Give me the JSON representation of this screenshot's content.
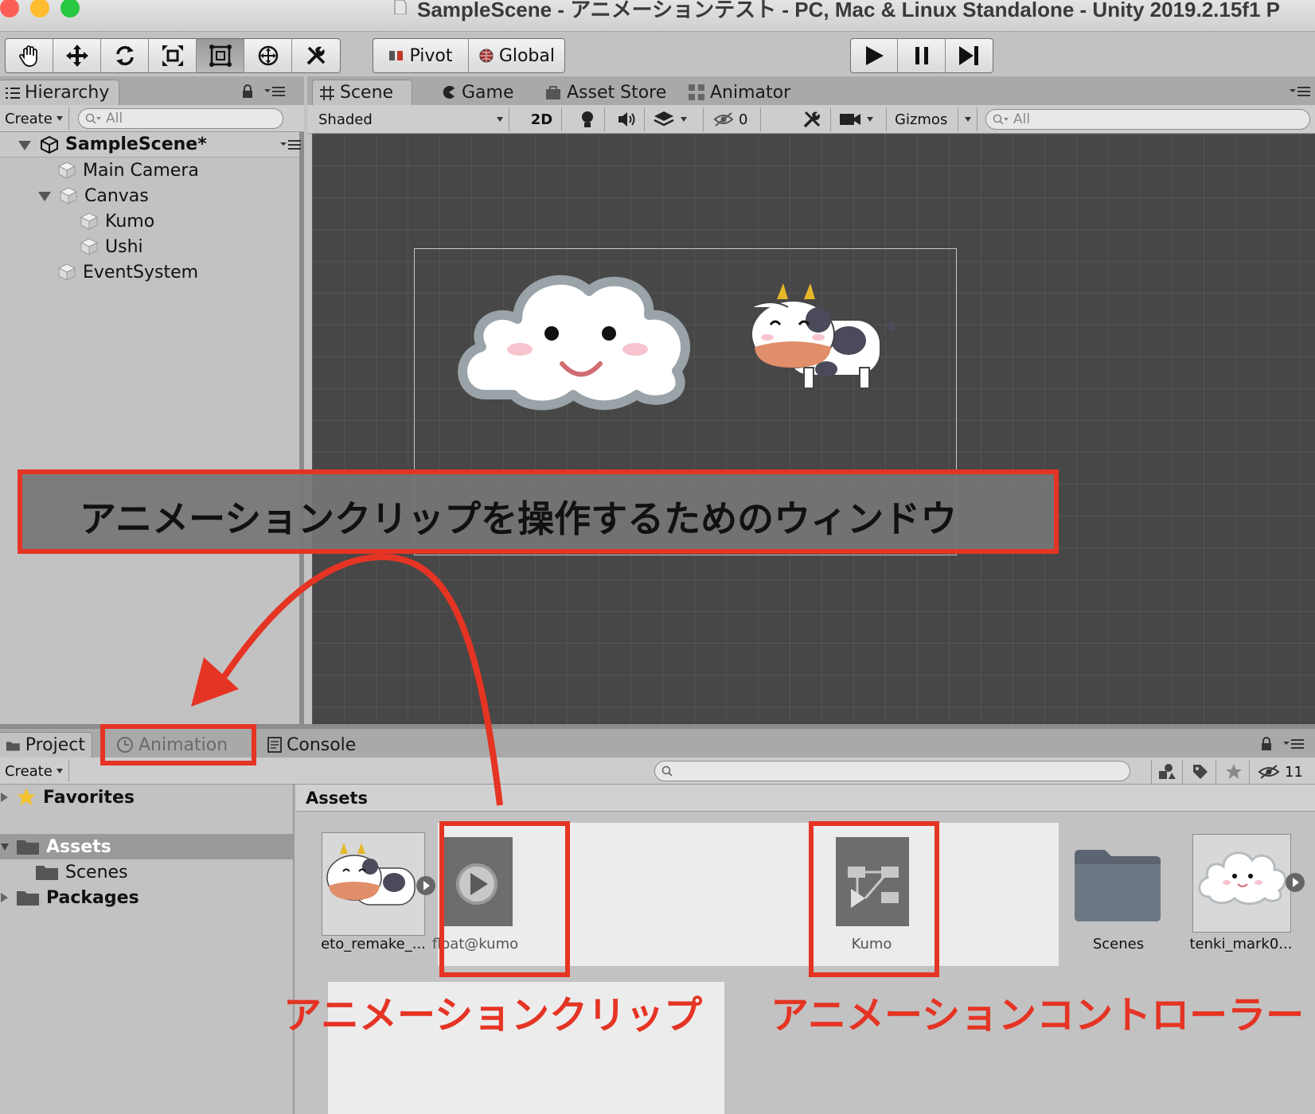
{
  "window": {
    "title": "SampleScene - アニメーションテスト - PC, Mac & Linux Standalone - Unity 2019.2.15f1 P"
  },
  "toolbar": {
    "tools": [
      "hand-icon",
      "move-icon",
      "rotate-icon",
      "scale-icon",
      "rect-icon",
      "transform-icon",
      "custom-tool-icon"
    ],
    "pivot_label": "Pivot",
    "global_label": "Global",
    "playback": [
      "play-icon",
      "pause-icon",
      "step-icon"
    ]
  },
  "hierarchy": {
    "tab_label": "Hierarchy",
    "create_label": "Create",
    "search_placeholder": "All",
    "scene_name": "SampleScene*",
    "items": [
      {
        "label": "Main Camera"
      },
      {
        "label": "Canvas"
      },
      {
        "label": "Kumo"
      },
      {
        "label": "Ushi"
      },
      {
        "label": "EventSystem"
      }
    ]
  },
  "scene_tabs": {
    "scene": "Scene",
    "game": "Game",
    "asset_store": "Asset Store",
    "animator": "Animator"
  },
  "scene_toolbar": {
    "shading": "Shaded",
    "mode_2d": "2D",
    "hidden_count": "0",
    "gizmos": "Gizmos",
    "search_placeholder": "All"
  },
  "bottom_tabs": {
    "project": "Project",
    "animation": "Animation",
    "console": "Console"
  },
  "project": {
    "create_label": "Create",
    "hidden_count": "11",
    "tree": {
      "favorites": "Favorites",
      "assets": "Assets",
      "scenes": "Scenes",
      "packages": "Packages"
    },
    "header": "Assets",
    "assets": [
      {
        "label": "eto_remake_...",
        "type": "sprite"
      },
      {
        "label": "float@kumo",
        "type": "animation-clip"
      },
      {
        "label": "Kumo",
        "type": "animator-controller"
      },
      {
        "label": "Scenes",
        "type": "folder"
      },
      {
        "label": "tenki_mark0...",
        "type": "sprite"
      }
    ]
  },
  "annotations": {
    "banner": "アニメーションクリップを操作するためのウィンドウ",
    "clip_label": "アニメーションクリップ",
    "controller_label": "アニメーションコントローラー",
    "accent_color": "#e53424"
  }
}
